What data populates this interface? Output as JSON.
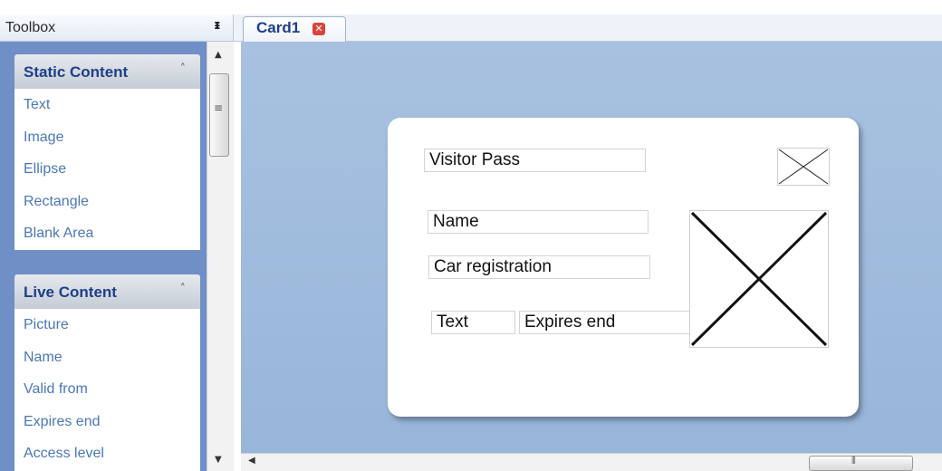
{
  "toolbox": {
    "title": "Toolbox",
    "pin_icon": "pin-icon",
    "groups": [
      {
        "title": "Static Content",
        "collapse_icon": "double-chevron-up-icon",
        "items": [
          "Text",
          "Image",
          "Ellipse",
          "Rectangle",
          "Blank Area"
        ]
      },
      {
        "title": "Live Content",
        "collapse_icon": "double-chevron-up-icon",
        "items": [
          "Picture",
          "Name",
          "Valid from",
          "Expires end",
          "Access level"
        ]
      }
    ]
  },
  "document": {
    "tab_label": "Card1",
    "tab_close_icon": "close-icon",
    "card": {
      "fields": {
        "title": "Visitor Pass",
        "name": "Name",
        "car": "Car registration",
        "text": "Text",
        "expires": "Expires end"
      },
      "logo_icon": "image-placeholder-icon",
      "photo_icon": "image-placeholder-icon"
    }
  },
  "colors": {
    "canvas": "#9fbbdd",
    "group_text": "#1d3e8a",
    "item_text": "#4a78b7",
    "toolbox_body": "#6f8fc6"
  }
}
